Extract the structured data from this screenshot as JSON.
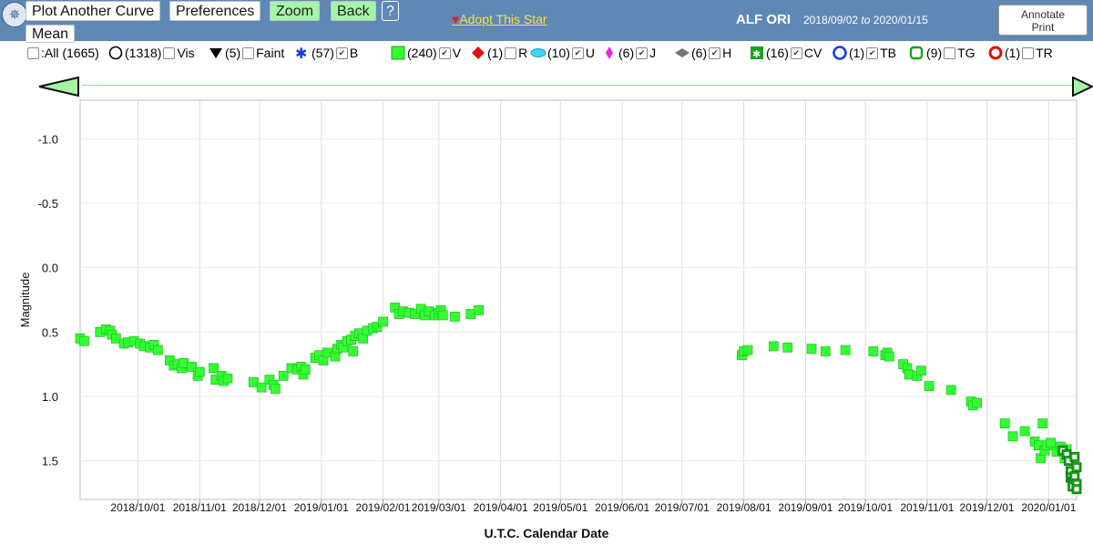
{
  "toolbar": {
    "plot_another": "Plot Another Curve",
    "preferences": "Preferences",
    "zoom": "Zoom",
    "back": "Back",
    "help": "?",
    "mean": "Mean",
    "adopt": "Adopt This Star",
    "star_name": "ALF ORI",
    "date_from": "2018/09/02",
    "date_to_word": "to",
    "date_to": "2020/01/15",
    "annotate": "Annotate",
    "print": "Print"
  },
  "colors": {
    "header_bg": "#5f88b5",
    "v_band": "#33ff33",
    "cv_band": "#1aa31a",
    "grid": "#dddddd"
  },
  "legend": [
    {
      "symbol": "none",
      "count": "",
      "label": ":All (1665)",
      "checked": false,
      "checkbox_first": true
    },
    {
      "symbol": "open-circle",
      "count": "(1318)",
      "label": "Vis",
      "checked": false
    },
    {
      "symbol": "down-triangle",
      "count": "(5)",
      "label": "Faint",
      "checked": false
    },
    {
      "symbol": "blue-star",
      "count": "(57)",
      "label": "B",
      "checked": true
    },
    {
      "symbol": "green-square",
      "count": "(240)",
      "label": "V",
      "checked": true
    },
    {
      "symbol": "red-diamond",
      "count": "(1)",
      "label": "R",
      "checked": false
    },
    {
      "symbol": "cyan-ellipse",
      "count": "(10)",
      "label": "U",
      "checked": true
    },
    {
      "symbol": "magenta-diamond",
      "count": "(6)",
      "label": "J",
      "checked": true
    },
    {
      "symbol": "gray-diamond",
      "count": "(6)",
      "label": "H",
      "checked": true
    },
    {
      "symbol": "green-star-square",
      "count": "(16)",
      "label": "CV",
      "checked": true
    },
    {
      "symbol": "blue-open-star",
      "count": "(1)",
      "label": "TB",
      "checked": true
    },
    {
      "symbol": "green-open-square",
      "count": "(9)",
      "label": "TG",
      "checked": false
    },
    {
      "symbol": "red-open-octagon",
      "count": "(1)",
      "label": "TR",
      "checked": false
    }
  ],
  "chart_data": {
    "type": "scatter",
    "title": "",
    "xlabel": "U.T.C. Calendar Date",
    "ylabel": "Magnitude",
    "x_range": [
      "2018-09-02",
      "2020-01-15"
    ],
    "ylim": [
      1.8,
      -1.3
    ],
    "y_inverted": true,
    "y_ticks": [
      -1.0,
      -0.5,
      0.0,
      0.5,
      1.0,
      1.5
    ],
    "y_tick_labels": [
      "-1.0",
      "-0.5",
      "0.0",
      "0.5",
      "1.0",
      "1.5"
    ],
    "x_ticks": [
      "2018-10-01",
      "2018-11-01",
      "2018-12-01",
      "2019-01-01",
      "2019-02-01",
      "2019-03-01",
      "2019-04-01",
      "2019-05-01",
      "2019-06-01",
      "2019-07-01",
      "2019-08-01",
      "2019-09-01",
      "2019-10-01",
      "2019-11-01",
      "2019-12-01",
      "2020-01-01"
    ],
    "x_tick_labels": [
      "2018/10/01",
      "2018/11/01",
      "2018/12/01",
      "2019/01/01",
      "2019/02/01",
      "2019/03/01",
      "2019/04/01",
      "2019/05/01",
      "2019/06/01",
      "2019/07/01",
      "2019/08/01",
      "2019/09/01",
      "2019/10/01",
      "2019/11/01",
      "2019/12/01",
      "2020/01/01"
    ],
    "grid": true,
    "series": [
      {
        "name": "V",
        "marker": "green-square",
        "points": [
          [
            "2018-09-02",
            0.55
          ],
          [
            "2018-09-04",
            0.57
          ],
          [
            "2018-09-12",
            0.5
          ],
          [
            "2018-09-15",
            0.48
          ],
          [
            "2018-09-17",
            0.49
          ],
          [
            "2018-09-18",
            0.52
          ],
          [
            "2018-09-20",
            0.55
          ],
          [
            "2018-09-24",
            0.59
          ],
          [
            "2018-09-26",
            0.58
          ],
          [
            "2018-09-29",
            0.57
          ],
          [
            "2018-10-02",
            0.59
          ],
          [
            "2018-10-04",
            0.61
          ],
          [
            "2018-10-07",
            0.62
          ],
          [
            "2018-10-09",
            0.6
          ],
          [
            "2018-10-11",
            0.64
          ],
          [
            "2018-10-17",
            0.72
          ],
          [
            "2018-10-19",
            0.76
          ],
          [
            "2018-10-21",
            0.75
          ],
          [
            "2018-10-23",
            0.78
          ],
          [
            "2018-10-24",
            0.74
          ],
          [
            "2018-10-28",
            0.77
          ],
          [
            "2018-10-31",
            0.84
          ],
          [
            "2018-11-01",
            0.81
          ],
          [
            "2018-11-08",
            0.78
          ],
          [
            "2018-11-09",
            0.87
          ],
          [
            "2018-11-12",
            0.84
          ],
          [
            "2018-11-13",
            0.88
          ],
          [
            "2018-11-15",
            0.86
          ],
          [
            "2018-11-28",
            0.89
          ],
          [
            "2018-12-02",
            0.93
          ],
          [
            "2018-12-06",
            0.87
          ],
          [
            "2018-12-08",
            0.91
          ],
          [
            "2018-12-09",
            0.94
          ],
          [
            "2018-12-13",
            0.84
          ],
          [
            "2018-12-17",
            0.78
          ],
          [
            "2018-12-20",
            0.79
          ],
          [
            "2018-12-22",
            0.77
          ],
          [
            "2018-12-23",
            0.83
          ],
          [
            "2018-12-24",
            0.79
          ],
          [
            "2018-12-29",
            0.7
          ],
          [
            "2018-12-31",
            0.68
          ],
          [
            "2019-01-02",
            0.72
          ],
          [
            "2019-01-04",
            0.66
          ],
          [
            "2019-01-08",
            0.69
          ],
          [
            "2019-01-09",
            0.63
          ],
          [
            "2019-01-11",
            0.6
          ],
          [
            "2019-01-12",
            0.62
          ],
          [
            "2019-01-14",
            0.57
          ],
          [
            "2019-01-16",
            0.56
          ],
          [
            "2019-01-17",
            0.65
          ],
          [
            "2019-01-18",
            0.53
          ],
          [
            "2019-01-20",
            0.51
          ],
          [
            "2019-01-22",
            0.55
          ],
          [
            "2019-01-24",
            0.49
          ],
          [
            "2019-01-27",
            0.47
          ],
          [
            "2019-01-29",
            0.46
          ],
          [
            "2019-02-01",
            0.42
          ],
          [
            "2019-02-07",
            0.31
          ],
          [
            "2019-02-09",
            0.36
          ],
          [
            "2019-02-11",
            0.34
          ],
          [
            "2019-02-14",
            0.35
          ],
          [
            "2019-02-17",
            0.36
          ],
          [
            "2019-02-20",
            0.32
          ],
          [
            "2019-02-22",
            0.37
          ],
          [
            "2019-02-24",
            0.34
          ],
          [
            "2019-02-27",
            0.37
          ],
          [
            "2019-03-01",
            0.35
          ],
          [
            "2019-03-02",
            0.33
          ],
          [
            "2019-03-03",
            0.37
          ],
          [
            "2019-03-09",
            0.38
          ],
          [
            "2019-03-17",
            0.36
          ],
          [
            "2019-03-21",
            0.33
          ],
          [
            "2019-07-31",
            0.68
          ],
          [
            "2019-08-01",
            0.65
          ],
          [
            "2019-08-03",
            0.64
          ],
          [
            "2019-08-16",
            0.61
          ],
          [
            "2019-08-23",
            0.62
          ],
          [
            "2019-09-04",
            0.63
          ],
          [
            "2019-09-11",
            0.65
          ],
          [
            "2019-09-21",
            0.64
          ],
          [
            "2019-10-05",
            0.65
          ],
          [
            "2019-10-11",
            0.68
          ],
          [
            "2019-10-12",
            0.66
          ],
          [
            "2019-10-13",
            0.69
          ],
          [
            "2019-10-20",
            0.75
          ],
          [
            "2019-10-22",
            0.78
          ],
          [
            "2019-10-23",
            0.83
          ],
          [
            "2019-10-27",
            0.84
          ],
          [
            "2019-10-29",
            0.8
          ],
          [
            "2019-11-02",
            0.92
          ],
          [
            "2019-11-13",
            0.95
          ],
          [
            "2019-11-23",
            1.04
          ],
          [
            "2019-11-24",
            1.07
          ],
          [
            "2019-11-26",
            1.05
          ],
          [
            "2019-12-10",
            1.21
          ],
          [
            "2019-12-14",
            1.31
          ],
          [
            "2019-12-20",
            1.27
          ],
          [
            "2019-12-25",
            1.35
          ],
          [
            "2019-12-27",
            1.38
          ],
          [
            "2019-12-28",
            1.48
          ],
          [
            "2019-12-29",
            1.21
          ],
          [
            "2019-12-30",
            1.42
          ],
          [
            "2019-12-31",
            1.38
          ],
          [
            "2020-01-02",
            1.36
          ],
          [
            "2020-01-05",
            1.43
          ],
          [
            "2020-01-07",
            1.39
          ],
          [
            "2020-01-09",
            1.48
          ],
          [
            "2020-01-10",
            1.41
          ]
        ]
      },
      {
        "name": "CV",
        "marker": "green-star-square",
        "points": [
          [
            "2020-01-08",
            1.42
          ],
          [
            "2020-01-10",
            1.45
          ],
          [
            "2020-01-11",
            1.5
          ],
          [
            "2020-01-12",
            1.58
          ],
          [
            "2020-01-12",
            1.63
          ],
          [
            "2020-01-13",
            1.66
          ],
          [
            "2020-01-13",
            1.7
          ],
          [
            "2020-01-14",
            1.62
          ],
          [
            "2020-01-15",
            1.68
          ],
          [
            "2020-01-15",
            1.72
          ],
          [
            "2020-01-14",
            1.47
          ],
          [
            "2020-01-15",
            1.55
          ]
        ]
      }
    ]
  }
}
